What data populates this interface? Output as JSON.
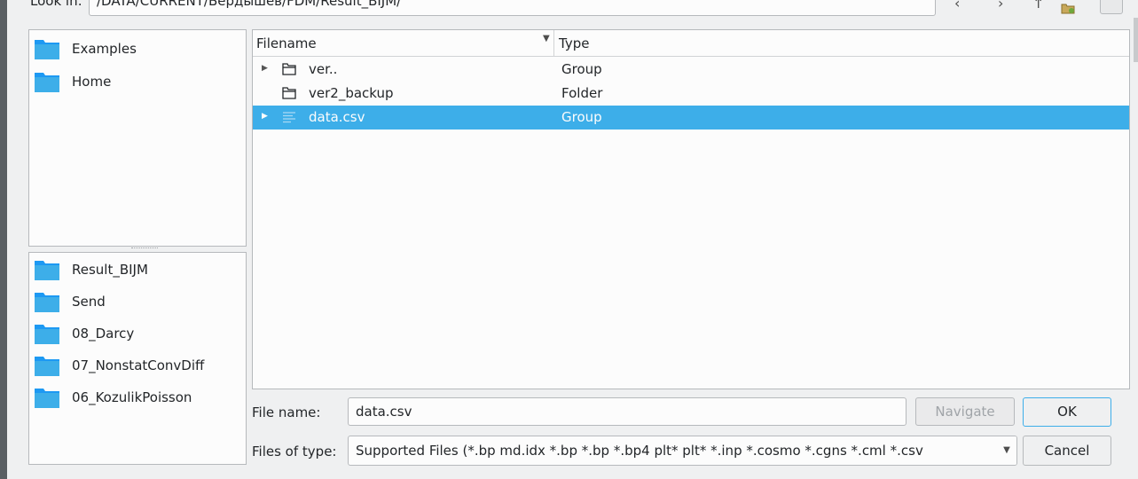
{
  "toolbar": {
    "look_in_label": "Look in:",
    "path": "/DATA/CURRENT/Бердышев/FDM/Result_BIJM/"
  },
  "places": {
    "top": [
      {
        "label": "Examples"
      },
      {
        "label": "Home"
      }
    ],
    "recent": [
      {
        "label": "Result_BIJM"
      },
      {
        "label": "Send"
      },
      {
        "label": "08_Darcy"
      },
      {
        "label": "07_NonstatConvDiff"
      },
      {
        "label": "06_KozulikPoisson"
      }
    ]
  },
  "files": {
    "columns": {
      "filename": "Filename",
      "type": "Type"
    },
    "rows": [
      {
        "name": "ver..",
        "type": "Group",
        "expandable": true,
        "icon": "folder-icon",
        "selected": false
      },
      {
        "name": "ver2_backup",
        "type": "Folder",
        "expandable": false,
        "icon": "folder-icon",
        "selected": false
      },
      {
        "name": "data.csv",
        "type": "Group",
        "expandable": true,
        "icon": "text-file-icon",
        "selected": true
      }
    ]
  },
  "form": {
    "file_name_label": "File name:",
    "file_name_value": "data.csv",
    "files_of_type_label": "Files of type:",
    "files_of_type_value": "Supported Files (*.bp md.idx *.bp *.bp *.bp4 plt* plt* *.inp *.cosmo *.cgns *.cml *.csv"
  },
  "buttons": {
    "navigate": "Navigate",
    "ok": "OK",
    "cancel": "Cancel"
  },
  "colors": {
    "selection": "#3daee9",
    "folder": "#1d99f3",
    "background": "#eff0f1"
  }
}
